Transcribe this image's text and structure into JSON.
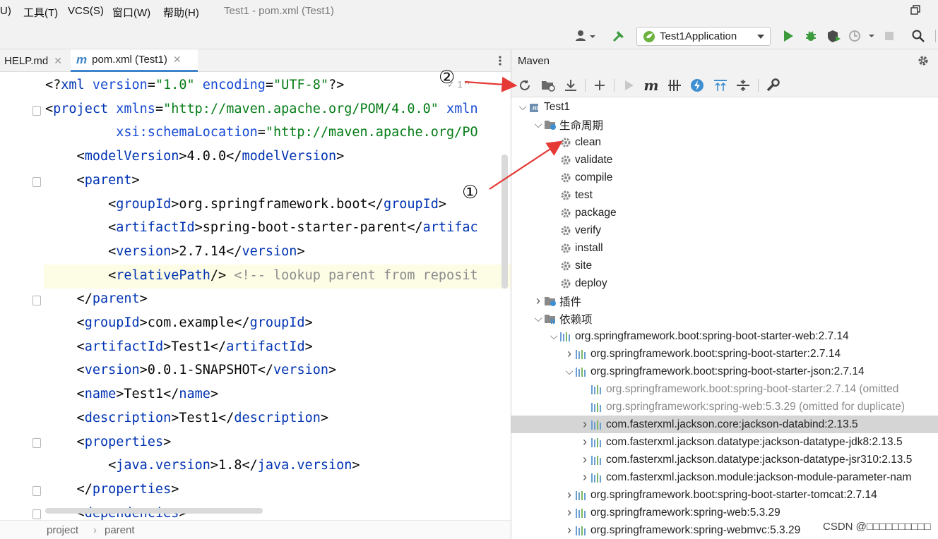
{
  "menubar": {
    "items": [
      "U)",
      "工具(T)",
      "VCS(S)",
      "窗口(W)",
      "帮助(H)"
    ],
    "title": "Test1 - pom.xml (Test1)"
  },
  "toolbar": {
    "run_config": "Test1Application"
  },
  "tabs": [
    {
      "label": "HELP.md"
    },
    {
      "label": "pom.xml (Test1)"
    }
  ],
  "editor": {
    "lines": [
      {
        "segments": [
          [
            "t",
            "<?"
          ],
          [
            "g",
            "xml"
          ],
          [
            "t",
            " "
          ],
          [
            "a",
            "version"
          ],
          [
            "t",
            "="
          ],
          [
            "s",
            "\"1.0\""
          ],
          [
            "t",
            " "
          ],
          [
            "a",
            "encoding"
          ],
          [
            "t",
            "="
          ],
          [
            "s",
            "\"UTF-8\""
          ],
          [
            "t",
            "?>"
          ]
        ]
      },
      {
        "segments": [
          [
            "t",
            "<"
          ],
          [
            "g",
            "project"
          ],
          [
            "t",
            " "
          ],
          [
            "a",
            "xmlns"
          ],
          [
            "t",
            "="
          ],
          [
            "s",
            "\"http://maven.apache.org/POM/4.0.0\""
          ],
          [
            "t",
            " "
          ],
          [
            "a",
            "xmln"
          ]
        ]
      },
      {
        "segments": [
          [
            "t",
            "         "
          ],
          [
            "a",
            "xsi:schemaLocation"
          ],
          [
            "t",
            "="
          ],
          [
            "s",
            "\"http://maven.apache.org/PO"
          ]
        ]
      },
      {
        "segments": [
          [
            "t",
            "    <"
          ],
          [
            "g",
            "modelVersion"
          ],
          [
            "t",
            ">4.0.0</"
          ],
          [
            "g",
            "modelVersion"
          ],
          [
            "t",
            ">"
          ]
        ]
      },
      {
        "segments": [
          [
            "t",
            "    <"
          ],
          [
            "g",
            "parent"
          ],
          [
            "t",
            ">"
          ]
        ]
      },
      {
        "segments": [
          [
            "t",
            "        <"
          ],
          [
            "g",
            "groupId"
          ],
          [
            "t",
            ">org.springframework.boot</"
          ],
          [
            "g",
            "groupId"
          ],
          [
            "t",
            ">"
          ]
        ]
      },
      {
        "segments": [
          [
            "t",
            "        <"
          ],
          [
            "g",
            "artifactId"
          ],
          [
            "t",
            ">spring-boot-starter-parent</"
          ],
          [
            "g",
            "artifac"
          ]
        ]
      },
      {
        "segments": [
          [
            "t",
            "        <"
          ],
          [
            "g",
            "version"
          ],
          [
            "t",
            ">2.7.14</"
          ],
          [
            "g",
            "version"
          ],
          [
            "t",
            ">"
          ]
        ]
      },
      {
        "segments": [
          [
            "t",
            "        <"
          ],
          [
            "g",
            "relativePath"
          ],
          [
            "t",
            "/> "
          ],
          [
            "c",
            "<!-- lookup parent from reposit"
          ]
        ]
      },
      {
        "segments": [
          [
            "t",
            "    </"
          ],
          [
            "g",
            "parent"
          ],
          [
            "t",
            ">"
          ]
        ]
      },
      {
        "segments": [
          [
            "t",
            "    <"
          ],
          [
            "g",
            "groupId"
          ],
          [
            "t",
            ">com.example</"
          ],
          [
            "g",
            "groupId"
          ],
          [
            "t",
            ">"
          ]
        ]
      },
      {
        "segments": [
          [
            "t",
            "    <"
          ],
          [
            "g",
            "artifactId"
          ],
          [
            "t",
            ">Test1</"
          ],
          [
            "g",
            "artifactId"
          ],
          [
            "t",
            ">"
          ]
        ]
      },
      {
        "segments": [
          [
            "t",
            "    <"
          ],
          [
            "g",
            "version"
          ],
          [
            "t",
            ">0.0.1-SNAPSHOT</"
          ],
          [
            "g",
            "version"
          ],
          [
            "t",
            ">"
          ]
        ]
      },
      {
        "segments": [
          [
            "t",
            "    <"
          ],
          [
            "g",
            "name"
          ],
          [
            "t",
            ">Test1</"
          ],
          [
            "g",
            "name"
          ],
          [
            "t",
            ">"
          ]
        ]
      },
      {
        "segments": [
          [
            "t",
            "    <"
          ],
          [
            "g",
            "description"
          ],
          [
            "t",
            ">Test1</"
          ],
          [
            "g",
            "description"
          ],
          [
            "t",
            ">"
          ]
        ]
      },
      {
        "segments": [
          [
            "t",
            "    <"
          ],
          [
            "g",
            "properties"
          ],
          [
            "t",
            ">"
          ]
        ]
      },
      {
        "segments": [
          [
            "t",
            "        <"
          ],
          [
            "g",
            "java.version"
          ],
          [
            "t",
            ">1.8</"
          ],
          [
            "g",
            "java.version"
          ],
          [
            "t",
            ">"
          ]
        ]
      },
      {
        "segments": [
          [
            "t",
            "    </"
          ],
          [
            "g",
            "properties"
          ],
          [
            "t",
            ">"
          ]
        ]
      },
      {
        "segments": [
          [
            "t",
            "    <"
          ],
          [
            "g",
            "dependencies"
          ],
          [
            "t",
            ">"
          ]
        ]
      }
    ]
  },
  "breadcrumb": [
    "project",
    "parent"
  ],
  "maven": {
    "title": "Maven",
    "tree": [
      {
        "label": "Test1",
        "indent": 0,
        "chev": "down",
        "icon": "maven-project-icon"
      },
      {
        "label": "生命周期",
        "indent": 1,
        "chev": "down",
        "icon": "lifecycle-folder-icon"
      },
      {
        "label": "clean",
        "indent": 2,
        "chev": "",
        "icon": "gear-icon"
      },
      {
        "label": "validate",
        "indent": 2,
        "chev": "",
        "icon": "gear-icon"
      },
      {
        "label": "compile",
        "indent": 2,
        "chev": "",
        "icon": "gear-icon"
      },
      {
        "label": "test",
        "indent": 2,
        "chev": "",
        "icon": "gear-icon"
      },
      {
        "label": "package",
        "indent": 2,
        "chev": "",
        "icon": "gear-icon"
      },
      {
        "label": "verify",
        "indent": 2,
        "chev": "",
        "icon": "gear-icon"
      },
      {
        "label": "install",
        "indent": 2,
        "chev": "",
        "icon": "gear-icon"
      },
      {
        "label": "site",
        "indent": 2,
        "chev": "",
        "icon": "gear-icon"
      },
      {
        "label": "deploy",
        "indent": 2,
        "chev": "",
        "icon": "gear-icon"
      },
      {
        "label": "插件",
        "indent": 1,
        "chev": "right",
        "icon": "plugins-folder-icon"
      },
      {
        "label": "依赖项",
        "indent": 1,
        "chev": "down",
        "icon": "dependencies-folder-icon"
      },
      {
        "label": "org.springframework.boot:spring-boot-starter-web:2.7.14",
        "indent": 2,
        "chev": "down",
        "icon": "library-icon"
      },
      {
        "label": "org.springframework.boot:spring-boot-starter:2.7.14",
        "indent": 3,
        "chev": "right",
        "icon": "library-icon"
      },
      {
        "label": "org.springframework.boot:spring-boot-starter-json:2.7.14",
        "indent": 3,
        "chev": "down",
        "icon": "library-icon"
      },
      {
        "label": "org.springframework.boot:spring-boot-starter:2.7.14 (omitted",
        "indent": 4,
        "chev": "",
        "icon": "library-icon",
        "omitted": true
      },
      {
        "label": "org.springframework:spring-web:5.3.29 (omitted for duplicate)",
        "indent": 4,
        "chev": "",
        "icon": "library-icon",
        "omitted": true
      },
      {
        "label": "com.fasterxml.jackson.core:jackson-databind:2.13.5",
        "indent": 4,
        "chev": "right",
        "icon": "library-icon",
        "selected": true
      },
      {
        "label": "com.fasterxml.jackson.datatype:jackson-datatype-jdk8:2.13.5",
        "indent": 4,
        "chev": "right",
        "icon": "library-icon"
      },
      {
        "label": "com.fasterxml.jackson.datatype:jackson-datatype-jsr310:2.13.5",
        "indent": 4,
        "chev": "right",
        "icon": "library-icon"
      },
      {
        "label": "com.fasterxml.jackson.module:jackson-module-parameter-nam",
        "indent": 4,
        "chev": "right",
        "icon": "library-icon"
      },
      {
        "label": "org.springframework.boot:spring-boot-starter-tomcat:2.7.14",
        "indent": 3,
        "chev": "right",
        "icon": "library-icon"
      },
      {
        "label": "org.springframework:spring-web:5.3.29",
        "indent": 3,
        "chev": "right",
        "icon": "library-icon"
      },
      {
        "label": "org.springframework:spring-webmvc:5.3.29",
        "indent": 3,
        "chev": "right",
        "icon": "library-icon"
      }
    ]
  },
  "annotations": {
    "one": "①",
    "two": "②"
  },
  "watermark": "CSDN @□□□□□□□□□□",
  "colors": {
    "tag": "#0033b3",
    "attr": "#174ad4",
    "string": "#067d17",
    "comment": "#8c8c8c",
    "accent": "#4083c9",
    "run_green": "#3c9b3c",
    "annotation_red": "#e53935"
  }
}
